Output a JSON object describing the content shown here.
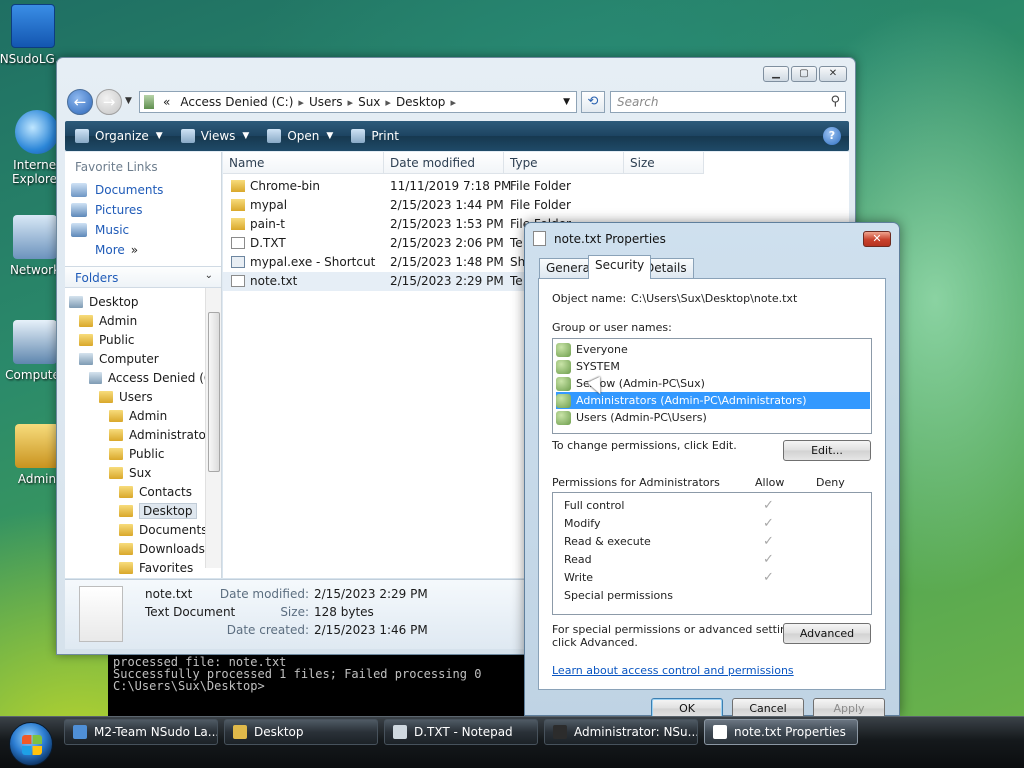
{
  "desktop": {
    "icons": [
      {
        "label": "NSudoLG..."
      },
      {
        "label": "Internet Explorer"
      },
      {
        "label": "Network"
      },
      {
        "label": "Computer"
      },
      {
        "label": "Admin"
      }
    ]
  },
  "explorer": {
    "address": {
      "root_chevron": "«",
      "segments": [
        "Access Denied (C:)",
        "Users",
        "Sux",
        "Desktop"
      ]
    },
    "search_placeholder": "Search",
    "toolbar": {
      "organize": "Organize",
      "views": "Views",
      "open": "Open",
      "print": "Print",
      "help": "?"
    },
    "favorites": {
      "header": "Favorite Links",
      "items": [
        "Documents",
        "Pictures",
        "Music",
        "More"
      ]
    },
    "folders": {
      "header": "Folders",
      "tree": [
        {
          "label": "Desktop",
          "level": 0
        },
        {
          "label": "Admin",
          "level": 1
        },
        {
          "label": "Public",
          "level": 1
        },
        {
          "label": "Computer",
          "level": 1
        },
        {
          "label": "Access Denied (C:)",
          "level": 2
        },
        {
          "label": "Users",
          "level": 3
        },
        {
          "label": "Admin",
          "level": 4
        },
        {
          "label": "Administrator",
          "level": 4
        },
        {
          "label": "Public",
          "level": 4
        },
        {
          "label": "Sux",
          "level": 4
        },
        {
          "label": "Contacts",
          "level": 5
        },
        {
          "label": "Desktop",
          "level": 5,
          "selected": true
        },
        {
          "label": "Documents",
          "level": 5
        },
        {
          "label": "Downloads",
          "level": 5
        },
        {
          "label": "Favorites",
          "level": 5
        }
      ]
    },
    "columns": [
      "Name",
      "Date modified",
      "Type",
      "Size"
    ],
    "files": [
      {
        "name": "Chrome-bin",
        "date": "11/11/2019 7:18 PM",
        "type": "File Folder",
        "kind": "folder"
      },
      {
        "name": "mypal",
        "date": "2/15/2023 1:44 PM",
        "type": "File Folder",
        "kind": "folder"
      },
      {
        "name": "pain-t",
        "date": "2/15/2023 1:53 PM",
        "type": "File Folder",
        "kind": "folder"
      },
      {
        "name": "D.TXT",
        "date": "2/15/2023 2:06 PM",
        "type": "Te",
        "kind": "txt"
      },
      {
        "name": "mypal.exe - Shortcut",
        "date": "2/15/2023 1:48 PM",
        "type": "Sh",
        "kind": "lnk"
      },
      {
        "name": "note.txt",
        "date": "2/15/2023 2:29 PM",
        "type": "Te",
        "kind": "txt",
        "selected": true
      }
    ],
    "details": {
      "name": "note.txt",
      "kind": "Text Document",
      "modified_label": "Date modified:",
      "modified_value": "2/15/2023 2:29 PM",
      "size_label": "Size:",
      "size_value": "128 bytes",
      "created_label": "Date created:",
      "created_value": "2/15/2023 1:46 PM"
    }
  },
  "console": {
    "lines": [
      "processed file: note.txt",
      "Successfully processed 1 files; Failed processing 0",
      "",
      "C:\\Users\\Sux\\Desktop>"
    ]
  },
  "properties": {
    "title": "note.txt Properties",
    "tabs": [
      "General",
      "Security",
      "Details"
    ],
    "active_tab": "Security",
    "object_name_label": "Object name:",
    "object_name_value": "C:\\Users\\Sux\\Desktop\\note.txt",
    "group_label": "Group or user names:",
    "groups": [
      {
        "name": "Everyone"
      },
      {
        "name": "SYSTEM"
      },
      {
        "name": "Sex ow (Admin-PC\\Sux)"
      },
      {
        "name": "Administrators (Admin-PC\\Administrators)",
        "selected": true
      },
      {
        "name": "Users (Admin-PC\\Users)"
      }
    ],
    "change_text": "To change permissions, click Edit.",
    "edit_button": "Edit...",
    "perm_label": "Permissions for Administrators",
    "allow_label": "Allow",
    "deny_label": "Deny",
    "permissions": [
      {
        "name": "Full control",
        "allow": true
      },
      {
        "name": "Modify",
        "allow": true
      },
      {
        "name": "Read & execute",
        "allow": true
      },
      {
        "name": "Read",
        "allow": true
      },
      {
        "name": "Write",
        "allow": true
      },
      {
        "name": "Special permissions",
        "allow": false
      }
    ],
    "special_text_1": "For special permissions or advanced settings,",
    "special_text_2": "click Advanced.",
    "advanced_button": "Advanced",
    "learn_link": "Learn about access control and permissions",
    "ok_button": "OK",
    "cancel_button": "Cancel",
    "apply_button": "Apply"
  },
  "taskbar": {
    "tasks": [
      {
        "label": "M2-Team NSudo La...",
        "active": false
      },
      {
        "label": "Desktop",
        "active": false
      },
      {
        "label": "D.TXT - Notepad",
        "active": false
      },
      {
        "label": "Administrator: NSu...",
        "active": false
      },
      {
        "label": "note.txt Properties",
        "active": true
      }
    ]
  },
  "colors": {
    "accent": "#3399ff",
    "toolbar": "#1d4461",
    "link": "#0a56c2"
  }
}
